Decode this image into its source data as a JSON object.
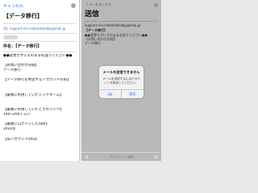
{
  "left": {
    "cancel_label": "キャンセル",
    "title": "【データ移行】",
    "to_address": "support-ms+dataidshiaby@miei.jp",
    "subject": "件名：【データ移行】",
    "body_lines": [
      "●●変更せずにそのままお送りください●●",
      "",
      "【お問い合わせ内容】",
      "データ移行",
      "",
      "【データ移行を希望するアカウントのID】",
      "",
      "",
      "【最後に利用していたニックネーム】",
      "",
      "",
      "【最後に利用していたときのランク】",
      "190~200くらい",
      "",
      "【最後にログインした日時】",
      "2022年",
      "",
      "【旧アカウントのID】"
    ]
  },
  "right": {
    "back_label": "〈 メールボックス",
    "title": "送信",
    "to_address": "support-ms+dataidshiaby@miei.jp",
    "subject": "【データ移行】",
    "body_lines": [
      "●●変更せずにそのままお送りください●●",
      "【お問い合わせ内容】",
      "データ移行"
    ],
    "dialog": {
      "title": "メールを送信できません",
      "message": "メールを送信するにはアカウントを設定してください。",
      "ok_label": "OK",
      "settings_label": "設定"
    },
    "bottom_label": "テンプレート 送信"
  }
}
